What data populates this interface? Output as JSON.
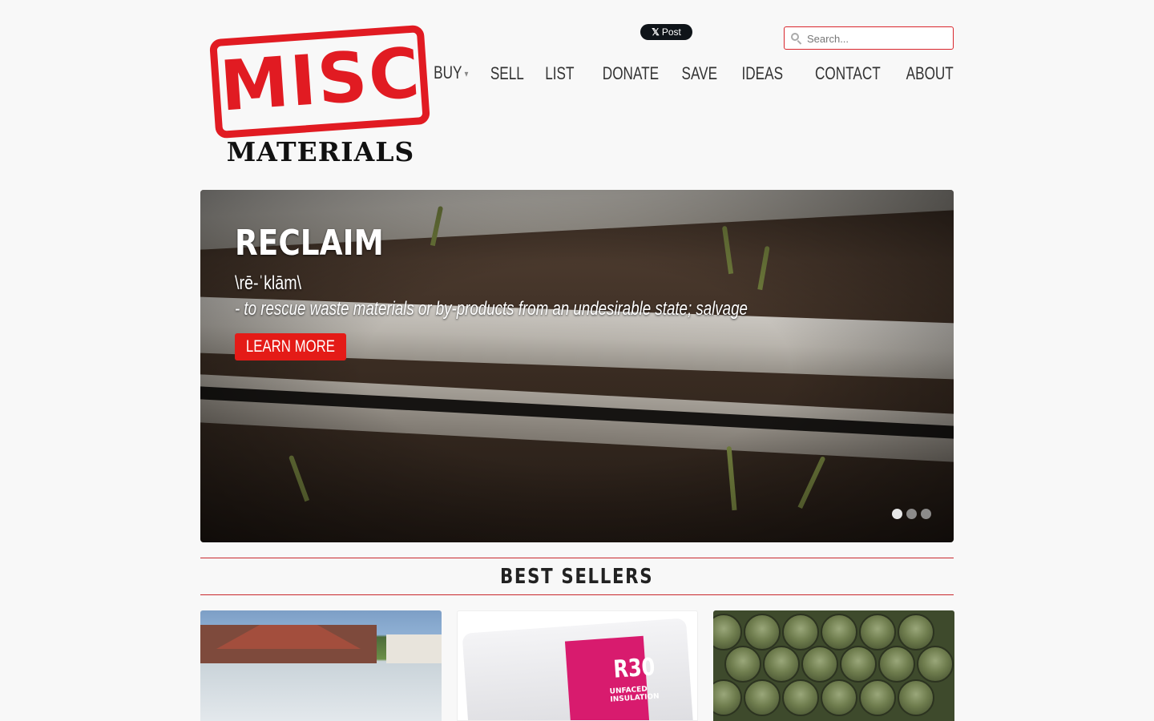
{
  "header": {
    "logo": {
      "line1": "MISC",
      "line2": "MATERIALS"
    },
    "x_post": {
      "label": "Post",
      "glyph": "𝕏"
    },
    "search": {
      "placeholder": "Search...",
      "value": ""
    }
  },
  "nav": {
    "items": [
      {
        "label": "BUY",
        "has_dropdown": true
      },
      {
        "label": "SELL"
      },
      {
        "label": "LIST"
      },
      {
        "label": "DONATE"
      },
      {
        "label": "SAVE"
      },
      {
        "label": "IDEAS"
      },
      {
        "label": "CONTACT"
      },
      {
        "label": "ABOUT"
      }
    ],
    "dropdown_caret": "▾"
  },
  "hero": {
    "title": "RECLAIM",
    "pronunciation": "\\rē-ˈklām\\",
    "definition": "- to rescue waste materials or by-products from an undesirable state; salvage",
    "cta_label": "LEARN MORE",
    "slide_count": 3,
    "active_slide": 1
  },
  "best_sellers": {
    "title": "BEST SELLERS",
    "products": [
      {
        "image": "pool-deck-pavers-photo"
      },
      {
        "image": "r30-insulation-photo",
        "badge": "R30",
        "badge_sub": "UNFACED INSULATION"
      },
      {
        "image": "wooden-barrels-photo"
      }
    ]
  },
  "colors": {
    "accent": "#e11b22",
    "button": "#e41b17",
    "background": "#f8f8f8",
    "nav_text": "#333333"
  }
}
